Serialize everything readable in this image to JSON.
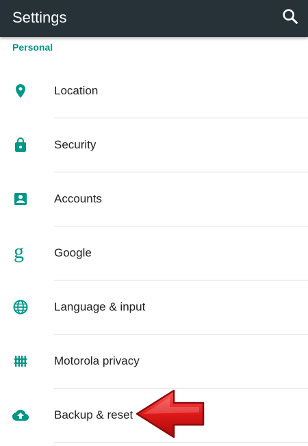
{
  "header": {
    "title": "Settings",
    "search_icon": "search-icon"
  },
  "section": {
    "title": "Personal"
  },
  "items": [
    {
      "label": "Location",
      "icon": "location-pin-icon"
    },
    {
      "label": "Security",
      "icon": "lock-icon"
    },
    {
      "label": "Accounts",
      "icon": "account-box-icon"
    },
    {
      "label": "Google",
      "icon": "google-g-icon",
      "glyph": "g"
    },
    {
      "label": "Language & input",
      "icon": "globe-icon"
    },
    {
      "label": "Motorola privacy",
      "icon": "motorola-privacy-icon"
    },
    {
      "label": "Backup & reset",
      "icon": "cloud-upload-icon"
    }
  ],
  "colors": {
    "topbar": "#263238",
    "accent": "#009688",
    "text": "#212121",
    "divider": "#dcdcdc",
    "arrow": "#d91e1e"
  },
  "annotation": {
    "icon": "red-arrow-pointer-icon"
  }
}
